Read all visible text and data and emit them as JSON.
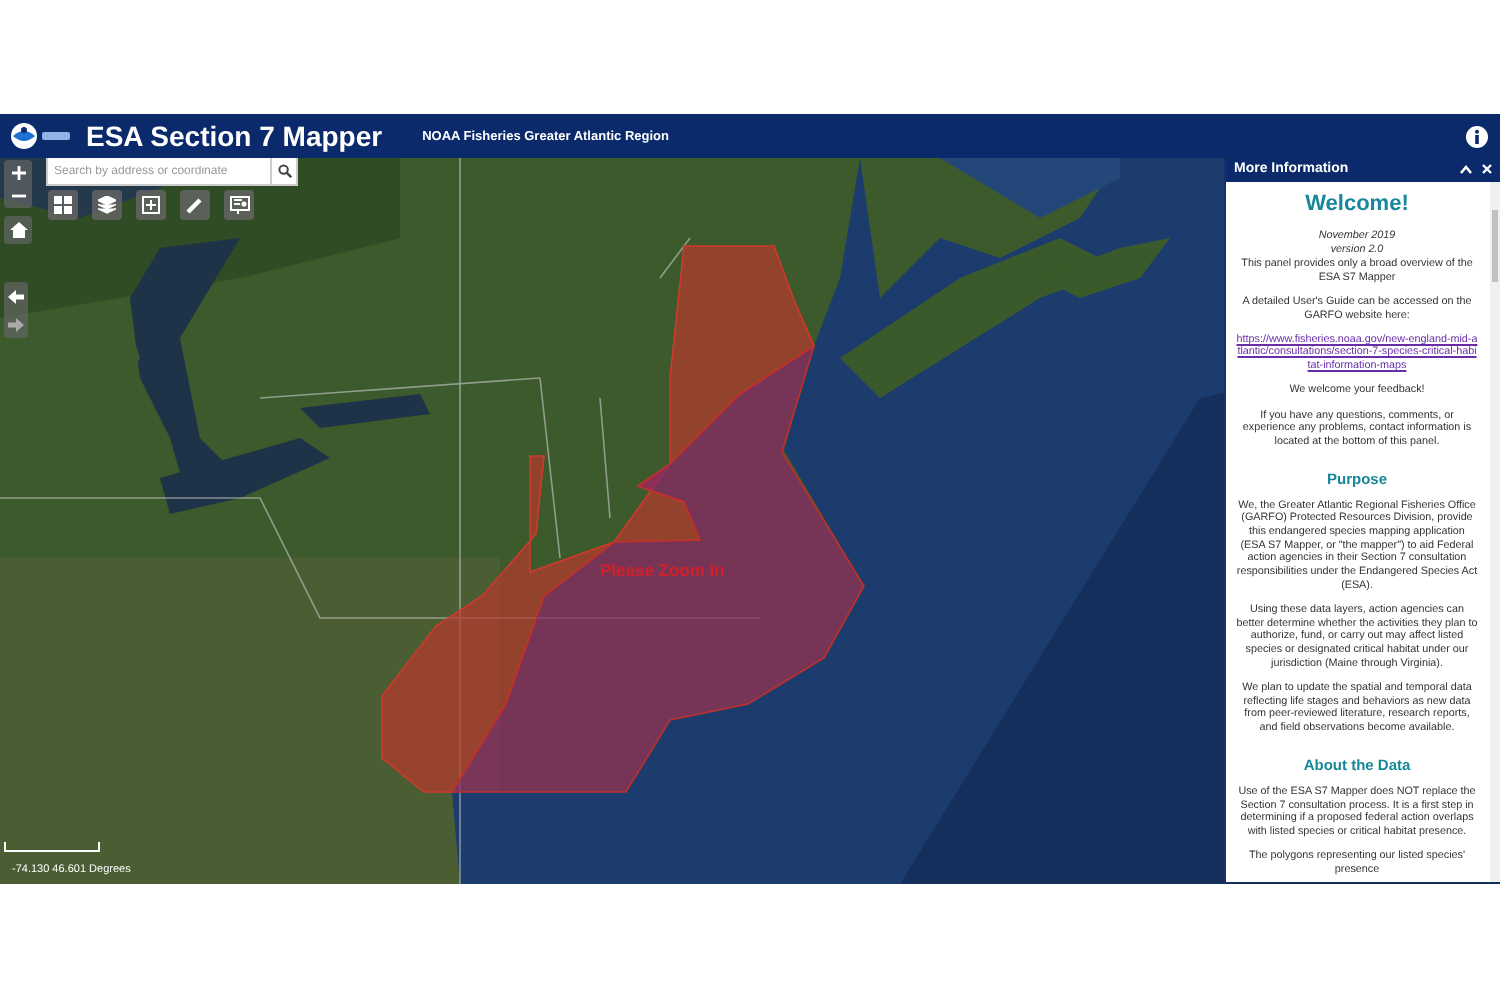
{
  "header": {
    "title": "ESA Section 7 Mapper",
    "subtitle": "NOAA Fisheries Greater Atlantic Region"
  },
  "map": {
    "search": {
      "placeholder": "Search by address or coordinate"
    },
    "overlay_label": "Please Zoom In",
    "coordinates": "-74.130 46.601 Degrees"
  },
  "panel": {
    "title": "More Information",
    "sections": [
      {
        "kind": "title",
        "text": "Welcome!"
      },
      {
        "kind": "note",
        "text": "November 2019"
      },
      {
        "kind": "note",
        "text": "version 2.0"
      },
      {
        "kind": "paragraph",
        "text": "This panel provides only a broad overview of the ESA S7 Mapper"
      },
      {
        "kind": "paragraph",
        "text": "A detailed User's Guide can be accessed on the GARFO website here:"
      },
      {
        "kind": "link",
        "text": "https://www.fisheries.noaa.gov/new-england-mid-atlantic/consultations/section-7-species-critical-habitat-information-maps"
      },
      {
        "kind": "paragraph",
        "text": "We welcome your feedback!"
      },
      {
        "kind": "paragraph",
        "text": "If you have any questions, comments, or experience any problems, contact information is located at the bottom of this panel."
      },
      {
        "kind": "heading",
        "text": "Purpose"
      },
      {
        "kind": "paragraph",
        "text": "We, the Greater Atlantic Regional Fisheries Office (GARFO) Protected Resources Division, provide this endangered species mapping application (ESA S7 Mapper, or \"the mapper\") to aid Federal action agencies in their Section 7 consultation responsibilities under the Endangered Species Act (ESA)."
      },
      {
        "kind": "paragraph",
        "text": "Using these data layers, action agencies can better determine whether the activities they plan to authorize, fund, or carry out may affect listed species or designated critical habitat under our jurisdiction (Maine through Virginia)."
      },
      {
        "kind": "paragraph",
        "text": "We plan to update the spatial and temporal data reflecting life stages and behaviors as new data from peer-reviewed literature, research reports, and field observations become available."
      },
      {
        "kind": "heading",
        "text": "About the Data"
      },
      {
        "kind": "paragraph",
        "text": "Use of the ESA S7 Mapper does NOT replace the Section 7 consultation process. It is a first step in determining if a proposed federal action overlaps with listed species or critical habitat presence."
      },
      {
        "kind": "paragraph",
        "text": "The polygons representing our listed species' presence"
      }
    ]
  }
}
